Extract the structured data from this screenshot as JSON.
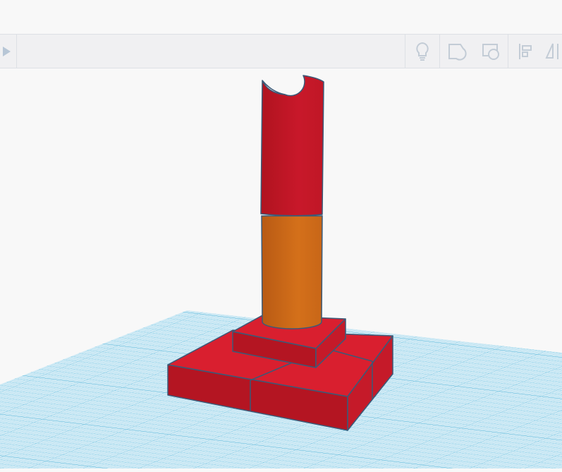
{
  "toolbar": {
    "icons": [
      "play-icon",
      "lightbulb-icon",
      "note-icon",
      "group-shape-icon",
      "align-icon",
      "mirror-icon"
    ]
  },
  "colors": {
    "toolbar_icon": "#c3ccd6",
    "workplane": "#a8d8ea",
    "grid_line": "#6cc3e0",
    "red_face": "#d91f2f",
    "red_dark": "#b41522",
    "orange": "#d06a18",
    "edge": "#3a5a78"
  }
}
